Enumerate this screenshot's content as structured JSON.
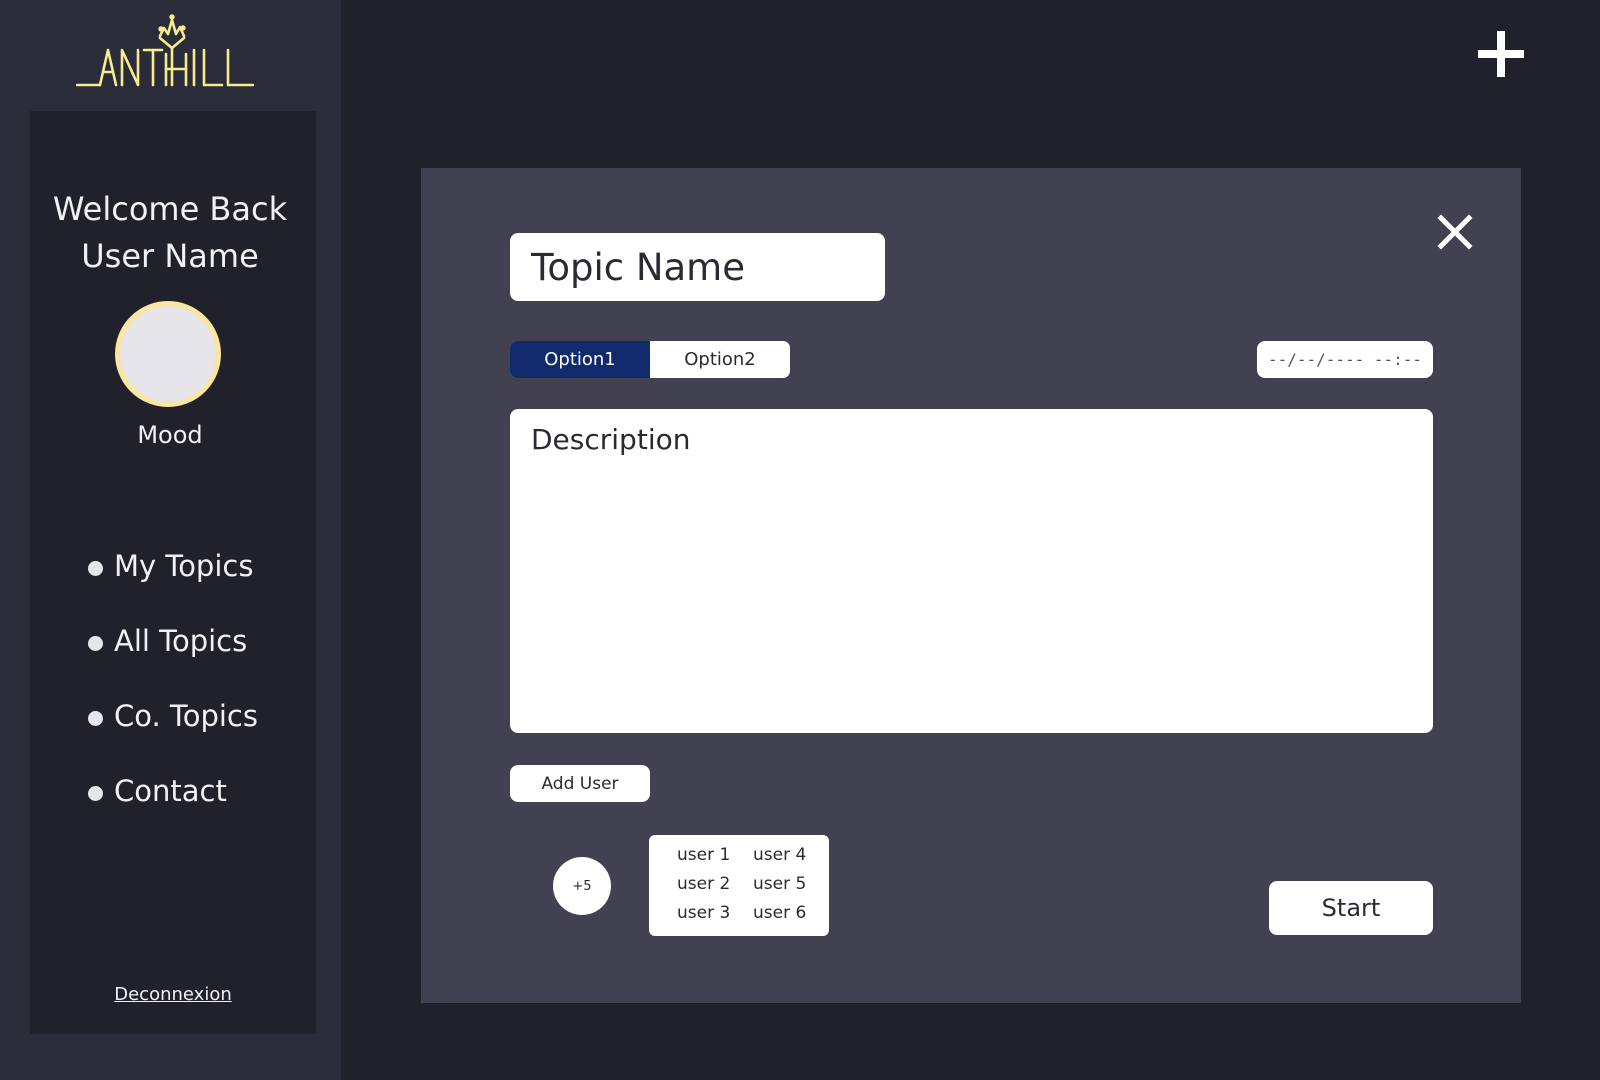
{
  "brand": {
    "name": "ANTHILL",
    "color": "#f8ec8e",
    "logo_icon": "anthill-crown-logo"
  },
  "sidebar": {
    "welcome_line1": "Welcome Back",
    "welcome_line2": "User Name",
    "mood_label": "Mood",
    "items": [
      {
        "label": "My Topics"
      },
      {
        "label": "All Topics"
      },
      {
        "label": "Co. Topics"
      },
      {
        "label": "Contact"
      }
    ],
    "logout_label": "Deconnexion"
  },
  "header": {
    "add_icon": "plus-icon"
  },
  "modal": {
    "close_icon": "close-icon",
    "topic_placeholder": "Topic Name",
    "options": [
      {
        "label": "Option1",
        "active": true
      },
      {
        "label": "Option2",
        "active": false
      }
    ],
    "datetime_placeholder": "--/--/----  --:--",
    "description_placeholder": "Description",
    "add_user_label": "Add User",
    "more_users_badge": "+5",
    "users": [
      "user 1",
      "user 4",
      "user 2",
      "user 5",
      "user 3",
      "user 6"
    ],
    "start_label": "Start"
  },
  "colors": {
    "background": "#21212c",
    "sidebar": "#2b2c3a",
    "modal": "#414152",
    "accent": "#102a6b",
    "avatar_ring": "#fae6a0"
  }
}
